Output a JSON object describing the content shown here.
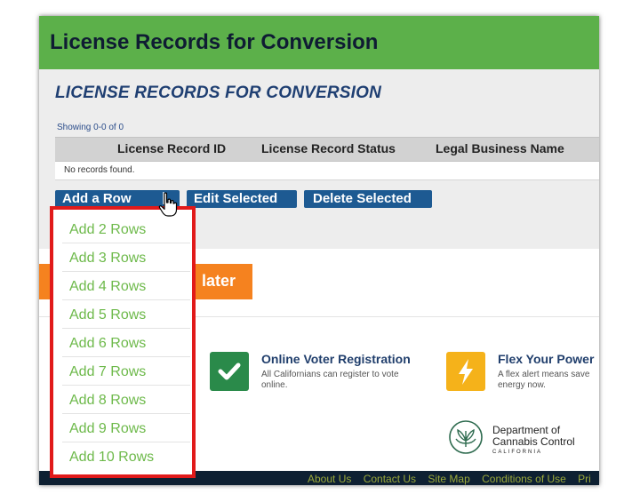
{
  "header": {
    "title": "License Records for Conversion"
  },
  "section": {
    "title": "LICENSE RECORDS FOR CONVERSION",
    "showing": "Showing 0-0 of 0",
    "columns": [
      "License Record ID",
      "License Record Status",
      "Legal Business Name"
    ],
    "empty_message": "No records found."
  },
  "toolbar": {
    "add_row": "Add a Row",
    "edit_selected": "Edit Selected",
    "delete_selected": "Delete Selected"
  },
  "dropdown": {
    "items": [
      "Add 2 Rows",
      "Add 3 Rows",
      "Add 4 Rows",
      "Add 5 Rows",
      "Add 6 Rows",
      "Add 7 Rows",
      "Add 8 Rows",
      "Add 9 Rows",
      "Add 10 Rows"
    ]
  },
  "action_button": {
    "label": "later"
  },
  "cards": [
    {
      "title": "Online Voter Registration",
      "desc": "All Californians can register to vote online.",
      "icon": "check-icon",
      "color": "#2a8a4a"
    },
    {
      "title": "Flex Your Power",
      "desc": "A flex alert means save energy now.",
      "icon": "lightning-icon",
      "color": "#f5b21a"
    }
  ],
  "logo": {
    "line1": "Department of",
    "line2": "Cannabis Control",
    "line3": "CALIFORNIA"
  },
  "footer": {
    "links": [
      "About Us",
      "Contact Us",
      "Site Map",
      "Conditions of Use",
      "Pri"
    ]
  },
  "colors": {
    "header_green": "#5cb04a",
    "button_blue": "#1d5a92",
    "orange": "#f5821f",
    "highlight_red": "#e11a1a",
    "footer_dark": "#0e2032"
  }
}
